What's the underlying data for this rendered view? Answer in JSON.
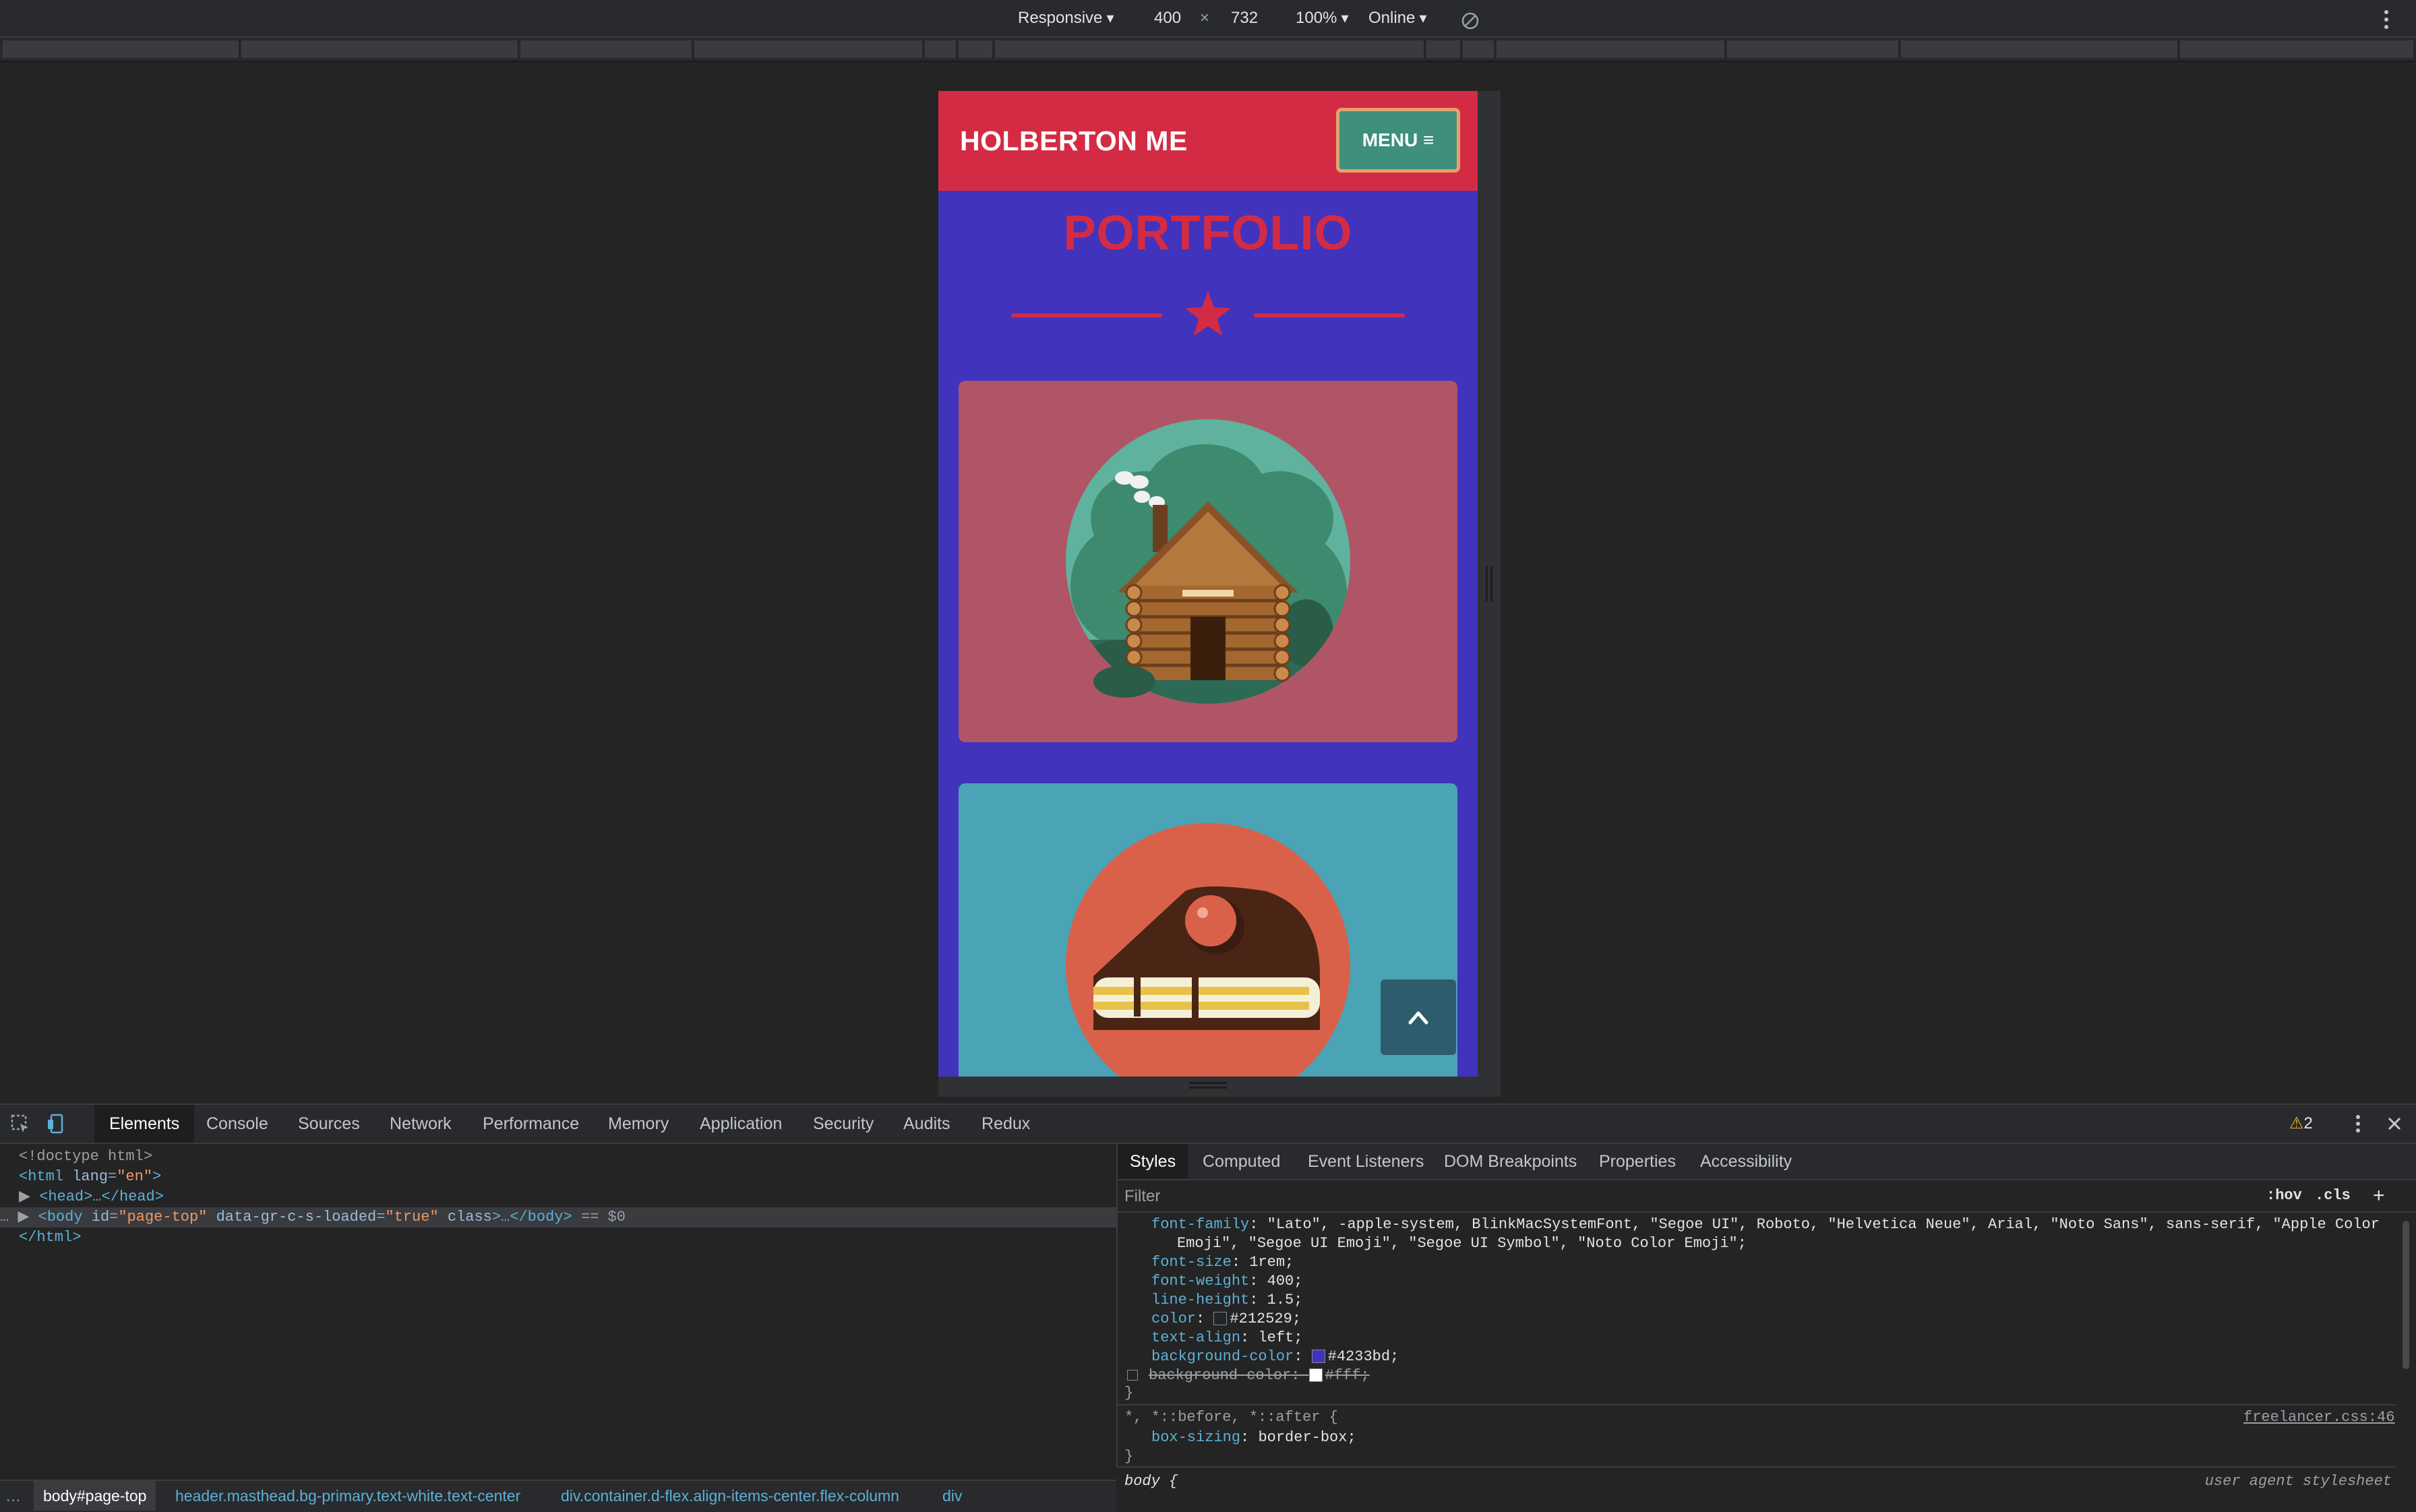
{
  "device_toolbar": {
    "device": "Responsive",
    "width": "400",
    "times": "×",
    "height": "732",
    "zoom": "100%",
    "network": "Online"
  },
  "page": {
    "brand": "HOLBERTON ME",
    "menu_label": "MENU ≡",
    "title": "PORTFOLIO",
    "cards": [
      {
        "name": "cabin",
        "bg": "#b05566"
      },
      {
        "name": "cake",
        "bg": "#4aa4b5"
      }
    ],
    "colors": {
      "primary": "#d42b44",
      "body_bg": "#4233bd",
      "menu_bg": "#3f8f7d",
      "menu_border": "#e2a36b"
    }
  },
  "devtools": {
    "tabs": [
      "Elements",
      "Console",
      "Sources",
      "Network",
      "Performance",
      "Memory",
      "Application",
      "Security",
      "Audits",
      "Redux"
    ],
    "active_tab": "Elements",
    "warnings": "2",
    "elements": {
      "doctype": "<!doctype html>",
      "html_open_tag": "html",
      "html_lang_attr": "lang",
      "html_lang_val": "\"en\"",
      "head": "<head>…</head>",
      "body_tag": "body",
      "body_id_attr": "id",
      "body_id_val": "\"page-top\"",
      "body_data_attr": "data-gr-c-s-loaded",
      "body_data_val": "\"true\"",
      "body_class_attr": "class",
      "body_tail": "…</body>",
      "selected_marker": "== $0",
      "html_close": "</html>"
    },
    "styles_tabs": [
      "Styles",
      "Computed",
      "Event Listeners",
      "DOM Breakpoints",
      "Properties",
      "Accessibility"
    ],
    "active_styles_tab": "Styles",
    "filter_placeholder": "Filter",
    "hov": ":hov",
    "cls": ".cls",
    "plus": "+",
    "rule1": {
      "font_family_prop": "font-family",
      "font_family_val_1": "\"Lato\", -apple-system, BlinkMacSystemFont, \"Segoe UI\", Roboto, \"Helvetica Neue\", Arial, \"Noto Sans\", sans-serif, \"Apple Color",
      "font_family_val_2": "Emoji\", \"Segoe UI Emoji\", \"Segoe UI Symbol\", \"Noto Color Emoji\";",
      "font_size_prop": "font-size",
      "font_size_val": "1rem;",
      "font_weight_prop": "font-weight",
      "font_weight_val": "400;",
      "line_height_prop": "line-height",
      "line_height_val": "1.5;",
      "color_prop": "color",
      "color_val": "#212529;",
      "color_hex": "#212529",
      "text_align_prop": "text-align",
      "text_align_val": "left;",
      "bg_prop": "background-color",
      "bg_val": "#4233bd;",
      "bg_hex": "#4233bd",
      "bg2_prop": "background-color",
      "bg2_val": "#fff;",
      "bg2_hex": "#ffffff",
      "close": "}"
    },
    "rule2": {
      "selector": "*, *::before, *::after {",
      "source": "freelancer.css:46",
      "prop": "box-sizing",
      "val": "border-box;",
      "close": "}"
    },
    "rule3": {
      "selector": "body {",
      "source": "user agent stylesheet"
    },
    "breadcrumbs": {
      "more": "…",
      "first": "body#page-top",
      "c2_tag": "header",
      "c2_cls": ".masthead.bg-primary.text-white.text-center",
      "c3_tag": "div",
      "c3_cls": ".container.d-flex.align-items-center.flex-column",
      "c4_tag": "div"
    }
  }
}
